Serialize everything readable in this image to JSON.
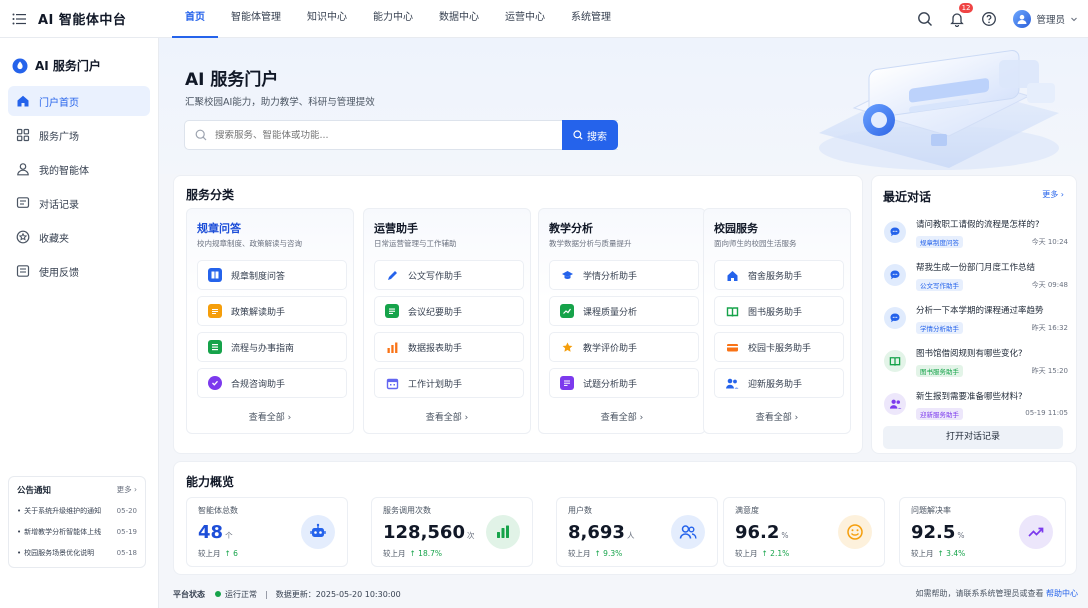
{
  "app": {
    "title": "AI 智能体中台"
  },
  "nav": [
    "首页",
    "智能体管理",
    "知识中心",
    "能力中心",
    "数据中心",
    "运营中心",
    "系统管理"
  ],
  "topbar": {
    "notification_count": "12",
    "user_name": "管理员"
  },
  "sidebar": {
    "portal_title": "AI 服务门户",
    "items": [
      {
        "label": "门户首页",
        "icon": "home-icon"
      },
      {
        "label": "服务广场",
        "icon": "grid-icon"
      },
      {
        "label": "我的智能体",
        "icon": "user-icon"
      },
      {
        "label": "对话记录",
        "icon": "chat-log-icon"
      },
      {
        "label": "收藏夹",
        "icon": "star-icon"
      },
      {
        "label": "使用反馈",
        "icon": "feedback-icon"
      }
    ],
    "notice": {
      "title": "公告通知",
      "more": "更多 ›",
      "items": [
        {
          "text": "关于系统升级维护的通知",
          "date": "05-20"
        },
        {
          "text": "新增教学分析智能体上线",
          "date": "05-19"
        },
        {
          "text": "校园服务场景优化说明",
          "date": "05-18"
        }
      ]
    }
  },
  "hero": {
    "title": "AI 服务门户",
    "subtitle": "汇聚校园AI能力，助力教学、科研与管理提效",
    "search_placeholder": "搜索服务、智能体或功能...",
    "search_button": "搜索"
  },
  "services": {
    "title": "服务分类",
    "view_all": "查看全部",
    "categories": [
      {
        "name": "规章问答",
        "desc": "校内规章制度、政策解读与咨询",
        "items": [
          "规章制度问答",
          "政策解读助手",
          "流程与办事指南",
          "合规咨询助手"
        ]
      },
      {
        "name": "运营助手",
        "desc": "日常运营管理与工作辅助",
        "items": [
          "公文写作助手",
          "会议纪要助手",
          "数据报表助手",
          "工作计划助手"
        ]
      },
      {
        "name": "教学分析",
        "desc": "教学数据分析与质量提升",
        "items": [
          "学情分析助手",
          "课程质量分析",
          "教学评价助手",
          "试题分析助手"
        ]
      },
      {
        "name": "校园服务",
        "desc": "面向师生的校园生活服务",
        "items": [
          "宿舍服务助手",
          "图书服务助手",
          "校园卡服务助手",
          "迎新服务助手"
        ]
      }
    ]
  },
  "recent": {
    "title": "最近对话",
    "more": "更多",
    "items": [
      {
        "question": "请问教职工请假的流程是怎样的?",
        "tag": "规章制度问答",
        "time": "今天 10:24"
      },
      {
        "question": "帮我生成一份部门月度工作总结",
        "tag": "公文写作助手",
        "time": "今天 09:48"
      },
      {
        "question": "分析一下本学期的课程通过率趋势",
        "tag": "学情分析助手",
        "time": "昨天 16:32"
      },
      {
        "question": "图书馆借阅规则有哪些变化?",
        "tag": "图书服务助手",
        "time": "昨天 15:20"
      },
      {
        "question": "新生报到需要准备哪些材料?",
        "tag": "迎新服务助手",
        "time": "05-19 11:05"
      }
    ],
    "open_button": "打开对话记录"
  },
  "overview": {
    "title": "能力概览",
    "compare_label": "较上月",
    "stats": [
      {
        "label": "智能体总数",
        "value": "48",
        "unit": "个",
        "change": "↑ 6"
      },
      {
        "label": "服务调用次数",
        "value": "128,560",
        "unit": "次",
        "change": "↑ 18.7%"
      },
      {
        "label": "用户数",
        "value": "8,693",
        "unit": "人",
        "change": "↑ 9.3%"
      },
      {
        "label": "满意度",
        "value": "96.2",
        "unit": "%",
        "change": "↑ 2.1%"
      },
      {
        "label": "问题解决率",
        "value": "92.5",
        "unit": "%",
        "change": "↑ 3.4%"
      }
    ]
  },
  "footer": {
    "status_label": "平台状态",
    "status_value": "运行正常",
    "update_label": "数据更新：2025-05-20 10:30:00",
    "help_text": "如需帮助，请联系系统管理员或查看",
    "help_link": "帮助中心"
  },
  "colors": {
    "primary": "#2563eb",
    "success": "#16a34a",
    "badge": "#ef4444"
  }
}
